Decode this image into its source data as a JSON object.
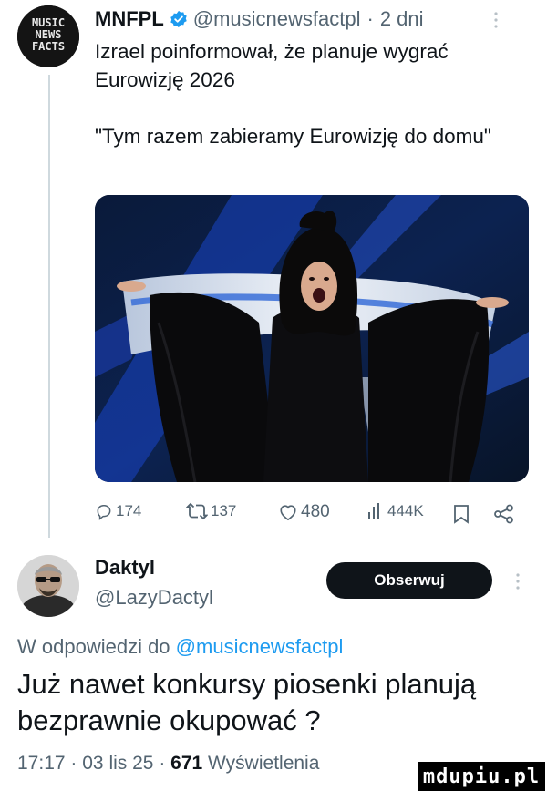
{
  "tweet": {
    "author_name": "MNFPL",
    "verified_icon": "verified-badge-icon",
    "handle": "@musicnewsfactpl",
    "separator": "·",
    "time_ago": "2 dni",
    "text_line1": "Izrael poinformował, że planuje wygrać Eurowizję 2026",
    "quote": "\"Tym razem zabieramy Eurowizję do domu\"",
    "avatar_text": [
      "MUSIC",
      "NEWS",
      "FACTS"
    ],
    "media_icon": "photo-performer-with-flag",
    "actions": {
      "replies": "174",
      "retweets": "137",
      "likes": "480",
      "views": "444K"
    }
  },
  "reply": {
    "author_name": "Daktyl",
    "handle": "@LazyDactyl",
    "follow_label": "Obserwuj",
    "in_reply_prefix": "W odpowiedzi do",
    "in_reply_mention": "@musicnewsfactpl",
    "text": "Już nawet konkursy piosenki planują bezprawnie okupować ?",
    "time": "17:17",
    "date": "03 lis 25",
    "views_count": "671",
    "views_label": "Wyświetlenia"
  },
  "watermark": "mdupiu.pl",
  "colors": {
    "accent": "#1d9bf0",
    "text": "#0f1419",
    "muted": "#536471",
    "follow_bg": "#0f1419"
  }
}
